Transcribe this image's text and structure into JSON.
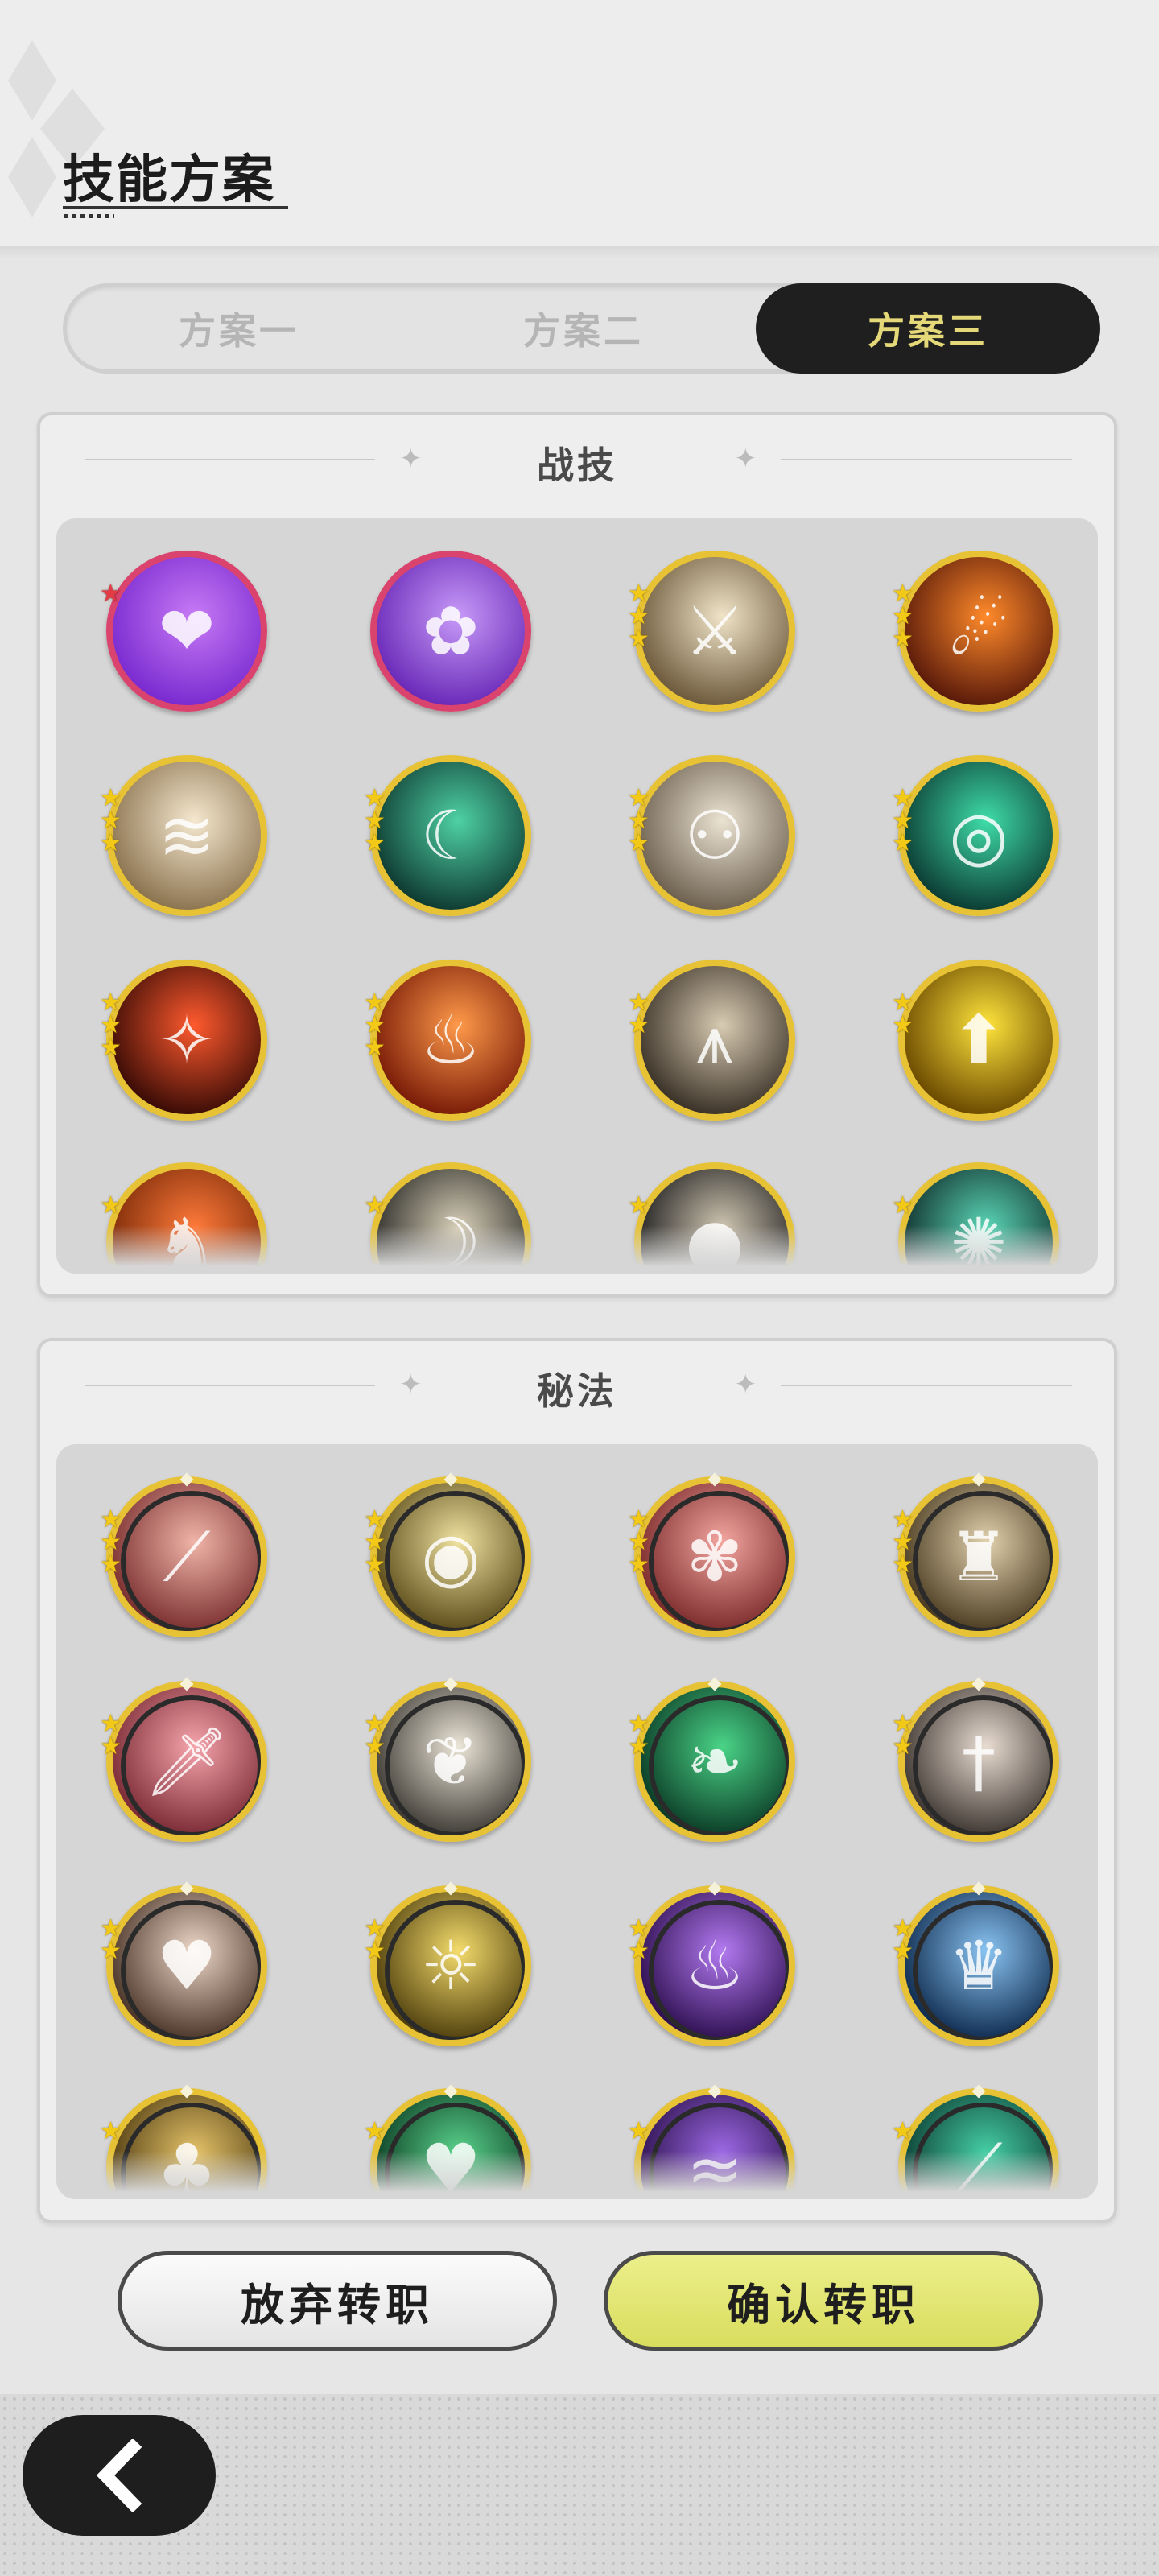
{
  "header": {
    "title": "技能方案"
  },
  "tabs": [
    {
      "label": "方案一",
      "active": false
    },
    {
      "label": "方案二",
      "active": false
    },
    {
      "label": "方案三",
      "active": true
    }
  ],
  "sections": {
    "battle": {
      "title": "战技",
      "skills": [
        {
          "name": "violet-heart-skill-icon",
          "colors": [
            "#7a2bd0",
            "#c77af5"
          ],
          "glyph": "❤",
          "border": "pink",
          "stars": 1,
          "star_color": "red"
        },
        {
          "name": "violet-roses-skill-icon",
          "colors": [
            "#6a2ab8",
            "#c79af8"
          ],
          "glyph": "✿",
          "border": "pink",
          "stars": 0
        },
        {
          "name": "golden-sword-strike-skill-icon",
          "colors": [
            "#6e5a3c",
            "#f0e4c8"
          ],
          "glyph": "⚔",
          "border": "gold",
          "stars": 3
        },
        {
          "name": "fire-swirl-skill-icon",
          "colors": [
            "#5a1a0a",
            "#ff8a2a"
          ],
          "glyph": "☄",
          "border": "gold",
          "stars": 3
        },
        {
          "name": "wind-slash-skill-icon",
          "colors": [
            "#8c7450",
            "#f5e8cf"
          ],
          "glyph": "≋",
          "border": "gold",
          "stars": 3
        },
        {
          "name": "jade-wave-skill-icon",
          "colors": [
            "#0f3b32",
            "#4ed1a4"
          ],
          "glyph": "☾",
          "border": "gold",
          "stars": 3
        },
        {
          "name": "phantom-dash-skill-icon",
          "colors": [
            "#6e6150",
            "#ebe3d2"
          ],
          "glyph": "⚇",
          "border": "gold",
          "stars": 3
        },
        {
          "name": "jade-ring-skill-icon",
          "colors": [
            "#0c3d34",
            "#3fdca8"
          ],
          "glyph": "◎",
          "border": "gold",
          "stars": 3
        },
        {
          "name": "flame-slash-skill-icon",
          "colors": [
            "#3a0c06",
            "#ff5a2e"
          ],
          "glyph": "✧",
          "border": "gold",
          "stars": 3
        },
        {
          "name": "flame-burst-skill-icon",
          "colors": [
            "#7a1c08",
            "#ff9a4a"
          ],
          "glyph": "♨",
          "border": "gold",
          "stars": 3
        },
        {
          "name": "spike-trap-skill-icon",
          "colors": [
            "#3b3228",
            "#d8cbb2"
          ],
          "glyph": "⩚",
          "border": "gold",
          "stars": 2
        },
        {
          "name": "golden-shield-up-skill-icon",
          "colors": [
            "#6b4a00",
            "#ffe43c"
          ],
          "glyph": "⬆",
          "border": "gold",
          "stars": 2
        },
        {
          "name": "fire-beast-skill-icon",
          "colors": [
            "#7a2a08",
            "#ff7a3a"
          ],
          "glyph": "♞",
          "border": "gold",
          "stars": 1
        },
        {
          "name": "crescent-bird-skill-icon",
          "colors": [
            "#2a2a26",
            "#d8cfb8"
          ],
          "glyph": "☽",
          "border": "gold",
          "stars": 1
        },
        {
          "name": "shadow-orb-skill-icon",
          "colors": [
            "#1c1c1c",
            "#d0c6b2"
          ],
          "glyph": "●",
          "border": "gold",
          "stars": 1
        },
        {
          "name": "jade-web-skill-icon",
          "colors": [
            "#0f2c2a",
            "#5ad6b6"
          ],
          "glyph": "✺",
          "border": "gold",
          "stars": 1
        }
      ]
    },
    "arcane": {
      "title": "秘法",
      "skills": [
        {
          "name": "crimson-claw-arcane-icon",
          "colors": [
            "#7a2f2f",
            "#f0b4a8"
          ],
          "glyph": "⟋",
          "stars": 3
        },
        {
          "name": "all-seeing-eye-arcane-icon",
          "colors": [
            "#5a4a18",
            "#efe2a0"
          ],
          "glyph": "◉",
          "stars": 3
        },
        {
          "name": "rose-bloom-arcane-icon",
          "colors": [
            "#7a2a2a",
            "#f3a6a0"
          ],
          "glyph": "✾",
          "stars": 3
        },
        {
          "name": "warrior-emblem-arcane-icon",
          "colors": [
            "#4a3a20",
            "#e2d2ae"
          ],
          "glyph": "♜",
          "stars": 3
        },
        {
          "name": "crimson-sword-arcane-icon",
          "colors": [
            "#7a2a34",
            "#f6a4ac"
          ],
          "glyph": "🗡",
          "stars": 2
        },
        {
          "name": "silver-leaf-arcane-icon",
          "colors": [
            "#3d3a34",
            "#ece6d8"
          ],
          "glyph": "❦",
          "stars": 2
        },
        {
          "name": "jade-feather-arcane-icon",
          "colors": [
            "#0b3b26",
            "#4ad487"
          ],
          "glyph": "❧",
          "stars": 2
        },
        {
          "name": "silver-dagger-arcane-icon",
          "colors": [
            "#3d3530",
            "#e9ddd2"
          ],
          "glyph": "†",
          "stars": 2
        },
        {
          "name": "heart-shield-arcane-icon",
          "colors": [
            "#4a3428",
            "#eed8c8"
          ],
          "glyph": "♥",
          "stars": 2
        },
        {
          "name": "golden-spirit-arcane-icon",
          "colors": [
            "#4e3e0c",
            "#f4dc6c"
          ],
          "glyph": "☼",
          "stars": 2
        },
        {
          "name": "violet-flame-arcane-icon",
          "colors": [
            "#2e0f50",
            "#b27af0"
          ],
          "glyph": "♨",
          "stars": 2
        },
        {
          "name": "azure-crown-arcane-icon",
          "colors": [
            "#0e2a4e",
            "#8ac4f2"
          ],
          "glyph": "♛",
          "stars": 2
        },
        {
          "name": "golden-beast-arcane-icon",
          "colors": [
            "#4e3a10",
            "#e6c46a"
          ],
          "glyph": "♣",
          "stars": 1
        },
        {
          "name": "jade-heart-arcane-icon",
          "colors": [
            "#0b3a22",
            "#5ad48c"
          ],
          "glyph": "♥",
          "stars": 1
        },
        {
          "name": "violet-wave-arcane-icon",
          "colors": [
            "#2a0f4a",
            "#9e6ae6"
          ],
          "glyph": "≈",
          "stars": 1
        },
        {
          "name": "jade-blade-arcane-icon",
          "colors": [
            "#0b3a30",
            "#46d0a6"
          ],
          "glyph": "⟋",
          "stars": 1
        }
      ]
    }
  },
  "buttons": {
    "abandon": "放弃转职",
    "confirm": "确认转职"
  },
  "colors": {
    "tab_active_bg": "#1f1f1f",
    "tab_active_text": "#e4d879",
    "confirm_bg": "#dfe36a",
    "gold_ring": "#e6c234",
    "pink_ring": "#d9436e"
  }
}
